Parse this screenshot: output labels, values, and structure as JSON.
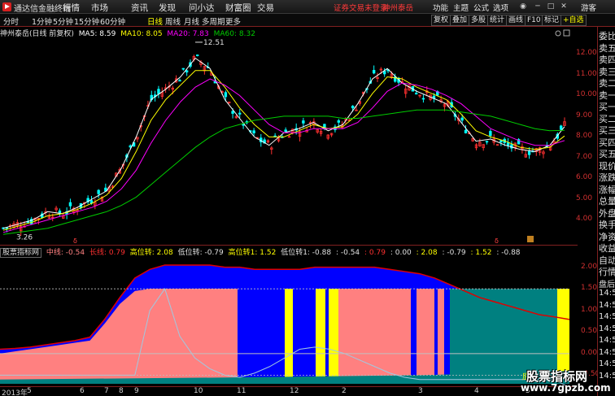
{
  "app": {
    "name": "通达信金融终端"
  },
  "menus": [
    "行情",
    "市场",
    "资讯",
    "发现",
    "问小达",
    "财富圈",
    "交易"
  ],
  "notice": "证券交易未登录",
  "stock_link": "神州泰岳",
  "right_menus": [
    "功能",
    "主题",
    "公式",
    "选项"
  ],
  "guest": "游客",
  "periods": [
    "分时",
    "1分钟",
    "5分钟",
    "15分钟",
    "60分钟",
    "日线",
    "周线",
    "月线",
    "多周期",
    "更多"
  ],
  "active_period": "日线",
  "tool_buttons": [
    "复权",
    "叠加",
    "多股",
    "统计",
    "画线",
    "F10",
    "标记",
    "+自选"
  ],
  "main_info": {
    "title": "神州泰岳(日线 前复权)",
    "ma5": "MA5: 8.59",
    "ma10": "MA10: 8.05",
    "ma20": "MA20: 7.83",
    "ma60": "MA60: 8.32"
  },
  "price_axis": [
    "12.00",
    "11.00",
    "10.00",
    "9.00",
    "8.00",
    "7.00",
    "6.00",
    "5.00",
    "4.00"
  ],
  "peak_label": "12.51",
  "low_label": "3.26",
  "sub_info": {
    "name": "股票指标网",
    "zx": "中线: -0.54",
    "cx": "长线: 0.79",
    "gwz": "高位转: 2.08",
    "dwz": "低位转: -0.79",
    "gwz1": "高位转1: 1.52",
    "dwz1": "低位转1: -0.88",
    "v1": ": -0.54",
    "v2": ": 0.79",
    "v3": ": 0.00",
    "v4": ": 2.08",
    "v5": ": -0.79",
    "v6": ": 1.52",
    "v7": ": -0.88"
  },
  "sub_axis": [
    "2.00",
    "1.50",
    "1.00",
    "0.50",
    "0.00",
    "-0.50"
  ],
  "x_labels": [
    "2013年",
    "5",
    "6",
    "7",
    "8",
    "9",
    "10",
    "11",
    "12",
    "2",
    "3",
    "4",
    "5"
  ],
  "right_panel": [
    "委比",
    "卖五",
    "卖四",
    "卖三",
    "卖二",
    "卖一",
    "买一",
    "买二",
    "买三",
    "买四",
    "买五",
    "现价",
    "涨跌",
    "涨幅",
    "总量",
    "外盘",
    "换手",
    "净资",
    "收益",
    "自动",
    "行情",
    "盘后",
    "14:5",
    "14:5",
    "14:5",
    "14:5",
    "14:5",
    "14:5",
    "14:5",
    "14:5"
  ],
  "watermark": {
    "line1": "股票指标网",
    "line2": "www.7gpzb.com"
  },
  "chart_data": [
    {
      "type": "line",
      "title": "神州泰岳(日线 前复权)",
      "ylim": [
        3.0,
        12.8
      ],
      "series": [
        {
          "name": "MA5",
          "color": "#ffffff",
          "values": [
            3.6,
            3.8,
            4.0,
            4.4,
            4.3,
            4.6,
            5.0,
            5.4,
            6.5,
            8.0,
            9.8,
            10.3,
            10.9,
            11.8,
            11.3,
            9.8,
            8.9,
            8.0,
            7.6,
            8.2,
            8.4,
            8.7,
            8.3,
            8.6,
            9.6,
            10.8,
            11.3,
            10.6,
            10.2,
            9.9,
            9.6,
            8.7,
            7.8,
            7.9,
            7.6,
            7.4,
            7.3,
            7.6,
            8.5
          ]
        },
        {
          "name": "MA10",
          "color": "#ffff00",
          "values": [
            3.5,
            3.7,
            3.9,
            4.2,
            4.3,
            4.5,
            4.8,
            5.2,
            6.0,
            7.3,
            8.8,
            9.8,
            10.5,
            11.2,
            11.2,
            10.4,
            9.4,
            8.6,
            8.0,
            8.0,
            8.3,
            8.6,
            8.4,
            8.5,
            9.1,
            10.1,
            10.9,
            10.8,
            10.4,
            10.1,
            9.8,
            9.1,
            8.3,
            8.0,
            7.8,
            7.5,
            7.4,
            7.5,
            8.05
          ]
        },
        {
          "name": "MA20",
          "color": "#ff00ff",
          "values": [
            3.4,
            3.6,
            3.8,
            4.0,
            4.2,
            4.4,
            4.6,
            4.9,
            5.5,
            6.4,
            7.7,
            8.8,
            9.7,
            10.4,
            10.8,
            10.5,
            10.0,
            9.3,
            8.6,
            8.2,
            8.2,
            8.4,
            8.4,
            8.4,
            8.7,
            9.4,
            10.2,
            10.6,
            10.5,
            10.3,
            10.0,
            9.6,
            9.0,
            8.4,
            8.1,
            7.8,
            7.6,
            7.6,
            7.83
          ]
        },
        {
          "name": "MA60",
          "color": "#00cc00",
          "values": [
            3.3,
            3.4,
            3.5,
            3.6,
            3.8,
            4.0,
            4.2,
            4.4,
            4.7,
            5.1,
            5.7,
            6.3,
            6.9,
            7.5,
            8.0,
            8.4,
            8.6,
            8.8,
            8.9,
            9.0,
            9.0,
            9.0,
            9.0,
            8.9,
            8.9,
            9.0,
            9.1,
            9.2,
            9.3,
            9.3,
            9.3,
            9.2,
            9.1,
            9.0,
            8.8,
            8.6,
            8.4,
            8.3,
            8.32
          ]
        }
      ]
    },
    {
      "type": "area",
      "title": "股票指标网",
      "ylim": [
        -0.7,
        2.2
      ],
      "series": [
        {
          "name": "中线",
          "color": "#ff8080",
          "values": [
            0.0,
            0.05,
            0.1,
            0.15,
            0.2,
            0.25,
            0.3,
            0.7,
            1.15,
            1.45,
            1.5,
            1.5,
            1.5,
            1.5,
            1.5,
            1.5,
            1.5,
            1.5,
            1.5,
            1.5,
            1.5,
            1.5,
            1.5,
            1.5,
            1.5,
            1.5,
            1.5,
            1.5,
            1.5,
            1.5,
            1.5,
            1.5,
            1.5,
            1.5,
            1.5,
            1.5,
            1.5,
            1.5,
            -0.54
          ]
        },
        {
          "name": "长线",
          "color": "#ff0000",
          "values": [
            0.1,
            0.12,
            0.15,
            0.2,
            0.25,
            0.3,
            0.38,
            0.8,
            1.3,
            1.75,
            1.95,
            2.05,
            2.05,
            2.05,
            2.05,
            2.0,
            2.0,
            1.95,
            1.95,
            1.95,
            1.95,
            2.0,
            2.0,
            2.0,
            2.0,
            2.0,
            1.95,
            1.9,
            1.85,
            1.75,
            1.6,
            1.45,
            1.3,
            1.2,
            1.1,
            1.0,
            0.9,
            0.85,
            0.79
          ]
        },
        {
          "name": "低位转",
          "color": "#a0c8e0",
          "values": [
            -0.5,
            -0.5,
            -0.5,
            -0.5,
            -0.5,
            -0.5,
            -0.5,
            -0.5,
            -0.5,
            -0.5,
            1.0,
            1.5,
            0.4,
            -0.1,
            -0.35,
            -0.5,
            -0.55,
            -0.45,
            -0.3,
            -0.1,
            0.1,
            0.15,
            0.1,
            0.0,
            -0.15,
            -0.3,
            -0.45,
            -0.55,
            -0.6,
            -0.6,
            -0.6,
            -0.6,
            -0.6,
            -0.6,
            -0.6,
            -0.6,
            -0.6,
            -0.6,
            -0.79
          ]
        }
      ]
    }
  ]
}
